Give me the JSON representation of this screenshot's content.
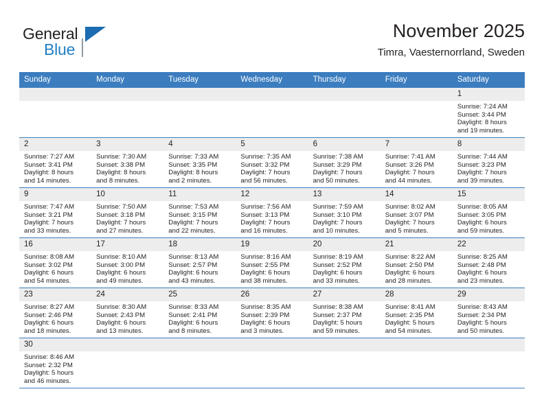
{
  "brand": {
    "name_top": "General",
    "name_bottom": "Blue",
    "logo_icon": "general-blue-flag-logo",
    "accent_color": "#1f7ec4"
  },
  "header": {
    "title": "November 2025",
    "subtitle": "Timra, Vaesternorrland, Sweden"
  },
  "theme": {
    "header_row_bg": "#3b7dbf",
    "daynum_bg": "#ededed",
    "text": "#231f20"
  },
  "calendar": {
    "weekday_headers": [
      "Sunday",
      "Monday",
      "Tuesday",
      "Wednesday",
      "Thursday",
      "Friday",
      "Saturday"
    ],
    "weeks": [
      [
        {
          "day": "",
          "lines": []
        },
        {
          "day": "",
          "lines": []
        },
        {
          "day": "",
          "lines": []
        },
        {
          "day": "",
          "lines": []
        },
        {
          "day": "",
          "lines": []
        },
        {
          "day": "",
          "lines": []
        },
        {
          "day": "1",
          "lines": [
            "Sunrise: 7:24 AM",
            "Sunset: 3:44 PM",
            "Daylight: 8 hours",
            "and 19 minutes."
          ]
        }
      ],
      [
        {
          "day": "2",
          "lines": [
            "Sunrise: 7:27 AM",
            "Sunset: 3:41 PM",
            "Daylight: 8 hours",
            "and 14 minutes."
          ]
        },
        {
          "day": "3",
          "lines": [
            "Sunrise: 7:30 AM",
            "Sunset: 3:38 PM",
            "Daylight: 8 hours",
            "and 8 minutes."
          ]
        },
        {
          "day": "4",
          "lines": [
            "Sunrise: 7:33 AM",
            "Sunset: 3:35 PM",
            "Daylight: 8 hours",
            "and 2 minutes."
          ]
        },
        {
          "day": "5",
          "lines": [
            "Sunrise: 7:35 AM",
            "Sunset: 3:32 PM",
            "Daylight: 7 hours",
            "and 56 minutes."
          ]
        },
        {
          "day": "6",
          "lines": [
            "Sunrise: 7:38 AM",
            "Sunset: 3:29 PM",
            "Daylight: 7 hours",
            "and 50 minutes."
          ]
        },
        {
          "day": "7",
          "lines": [
            "Sunrise: 7:41 AM",
            "Sunset: 3:26 PM",
            "Daylight: 7 hours",
            "and 44 minutes."
          ]
        },
        {
          "day": "8",
          "lines": [
            "Sunrise: 7:44 AM",
            "Sunset: 3:23 PM",
            "Daylight: 7 hours",
            "and 39 minutes."
          ]
        }
      ],
      [
        {
          "day": "9",
          "lines": [
            "Sunrise: 7:47 AM",
            "Sunset: 3:21 PM",
            "Daylight: 7 hours",
            "and 33 minutes."
          ]
        },
        {
          "day": "10",
          "lines": [
            "Sunrise: 7:50 AM",
            "Sunset: 3:18 PM",
            "Daylight: 7 hours",
            "and 27 minutes."
          ]
        },
        {
          "day": "11",
          "lines": [
            "Sunrise: 7:53 AM",
            "Sunset: 3:15 PM",
            "Daylight: 7 hours",
            "and 22 minutes."
          ]
        },
        {
          "day": "12",
          "lines": [
            "Sunrise: 7:56 AM",
            "Sunset: 3:13 PM",
            "Daylight: 7 hours",
            "and 16 minutes."
          ]
        },
        {
          "day": "13",
          "lines": [
            "Sunrise: 7:59 AM",
            "Sunset: 3:10 PM",
            "Daylight: 7 hours",
            "and 10 minutes."
          ]
        },
        {
          "day": "14",
          "lines": [
            "Sunrise: 8:02 AM",
            "Sunset: 3:07 PM",
            "Daylight: 7 hours",
            "and 5 minutes."
          ]
        },
        {
          "day": "15",
          "lines": [
            "Sunrise: 8:05 AM",
            "Sunset: 3:05 PM",
            "Daylight: 6 hours",
            "and 59 minutes."
          ]
        }
      ],
      [
        {
          "day": "16",
          "lines": [
            "Sunrise: 8:08 AM",
            "Sunset: 3:02 PM",
            "Daylight: 6 hours",
            "and 54 minutes."
          ]
        },
        {
          "day": "17",
          "lines": [
            "Sunrise: 8:10 AM",
            "Sunset: 3:00 PM",
            "Daylight: 6 hours",
            "and 49 minutes."
          ]
        },
        {
          "day": "18",
          "lines": [
            "Sunrise: 8:13 AM",
            "Sunset: 2:57 PM",
            "Daylight: 6 hours",
            "and 43 minutes."
          ]
        },
        {
          "day": "19",
          "lines": [
            "Sunrise: 8:16 AM",
            "Sunset: 2:55 PM",
            "Daylight: 6 hours",
            "and 38 minutes."
          ]
        },
        {
          "day": "20",
          "lines": [
            "Sunrise: 8:19 AM",
            "Sunset: 2:52 PM",
            "Daylight: 6 hours",
            "and 33 minutes."
          ]
        },
        {
          "day": "21",
          "lines": [
            "Sunrise: 8:22 AM",
            "Sunset: 2:50 PM",
            "Daylight: 6 hours",
            "and 28 minutes."
          ]
        },
        {
          "day": "22",
          "lines": [
            "Sunrise: 8:25 AM",
            "Sunset: 2:48 PM",
            "Daylight: 6 hours",
            "and 23 minutes."
          ]
        }
      ],
      [
        {
          "day": "23",
          "lines": [
            "Sunrise: 8:27 AM",
            "Sunset: 2:46 PM",
            "Daylight: 6 hours",
            "and 18 minutes."
          ]
        },
        {
          "day": "24",
          "lines": [
            "Sunrise: 8:30 AM",
            "Sunset: 2:43 PM",
            "Daylight: 6 hours",
            "and 13 minutes."
          ]
        },
        {
          "day": "25",
          "lines": [
            "Sunrise: 8:33 AM",
            "Sunset: 2:41 PM",
            "Daylight: 6 hours",
            "and 8 minutes."
          ]
        },
        {
          "day": "26",
          "lines": [
            "Sunrise: 8:35 AM",
            "Sunset: 2:39 PM",
            "Daylight: 6 hours",
            "and 3 minutes."
          ]
        },
        {
          "day": "27",
          "lines": [
            "Sunrise: 8:38 AM",
            "Sunset: 2:37 PM",
            "Daylight: 5 hours",
            "and 59 minutes."
          ]
        },
        {
          "day": "28",
          "lines": [
            "Sunrise: 8:41 AM",
            "Sunset: 2:35 PM",
            "Daylight: 5 hours",
            "and 54 minutes."
          ]
        },
        {
          "day": "29",
          "lines": [
            "Sunrise: 8:43 AM",
            "Sunset: 2:34 PM",
            "Daylight: 5 hours",
            "and 50 minutes."
          ]
        }
      ],
      [
        {
          "day": "30",
          "lines": [
            "Sunrise: 8:46 AM",
            "Sunset: 2:32 PM",
            "Daylight: 5 hours",
            "and 46 minutes."
          ]
        },
        {
          "day": "",
          "lines": []
        },
        {
          "day": "",
          "lines": []
        },
        {
          "day": "",
          "lines": []
        },
        {
          "day": "",
          "lines": []
        },
        {
          "day": "",
          "lines": []
        },
        {
          "day": "",
          "lines": []
        }
      ]
    ]
  }
}
